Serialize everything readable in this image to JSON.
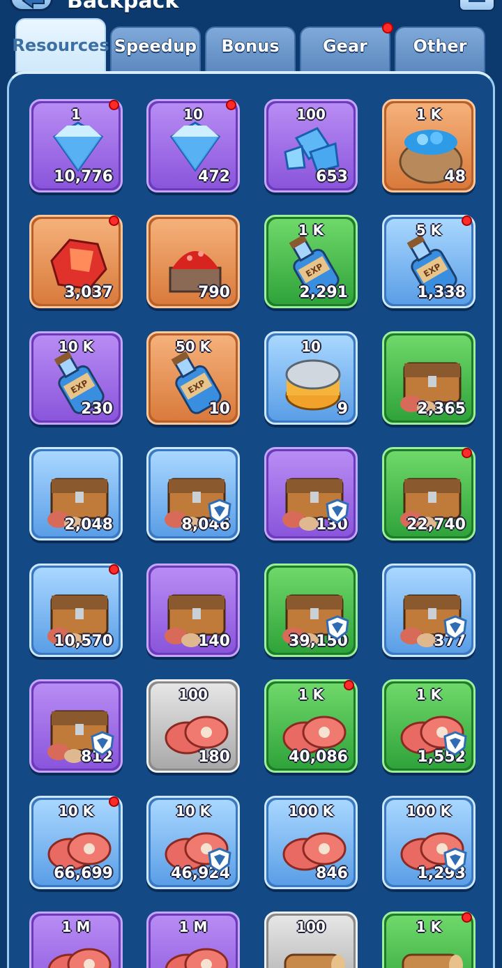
{
  "header": {
    "title": "Backpack",
    "back_icon": "back-arrow-icon",
    "menu_icon": "list-menu-icon"
  },
  "tabs": [
    {
      "label": "Resources",
      "active": true,
      "dot": false
    },
    {
      "label": "Speedup",
      "active": false,
      "dot": false
    },
    {
      "label": "Bonus",
      "active": false,
      "dot": false
    },
    {
      "label": "Gear",
      "active": false,
      "dot": true
    },
    {
      "label": "Other",
      "active": false,
      "dot": false
    }
  ],
  "colors": {
    "purple": "#8a55db",
    "orange": "#d97a3c",
    "green": "#2fa33a",
    "blue": "#5a9ee6",
    "gray": "#a9a9a9",
    "dot": "#ff2b2b",
    "panel": "#134a86"
  },
  "items": [
    {
      "rarity": "purple",
      "icon": "gem-single-icon",
      "denom": "1",
      "count": "10,776",
      "dot": true,
      "shield": false
    },
    {
      "rarity": "purple",
      "icon": "gem-pile-icon",
      "denom": "10",
      "count": "472",
      "dot": true,
      "shield": false
    },
    {
      "rarity": "purple",
      "icon": "gem-cluster-icon",
      "denom": "100",
      "count": "653",
      "dot": false,
      "shield": false
    },
    {
      "rarity": "orange",
      "icon": "gem-sack-icon",
      "denom": "1 K",
      "count": "48",
      "dot": false,
      "shield": false
    },
    {
      "rarity": "orange",
      "icon": "ruby-ore-icon",
      "denom": "",
      "count": "3,037",
      "dot": true,
      "shield": false
    },
    {
      "rarity": "orange",
      "icon": "ruby-cart-icon",
      "denom": "",
      "count": "790",
      "dot": false,
      "shield": false
    },
    {
      "rarity": "green",
      "icon": "exp-bottle-icon",
      "denom": "1 K",
      "count": "2,291",
      "dot": false,
      "shield": false
    },
    {
      "rarity": "blue",
      "icon": "exp-bottle-icon",
      "denom": "5 K",
      "count": "1,338",
      "dot": true,
      "shield": false
    },
    {
      "rarity": "purple",
      "icon": "exp-bottle-icon",
      "denom": "10 K",
      "count": "230",
      "dot": false,
      "shield": false
    },
    {
      "rarity": "orange",
      "icon": "exp-bottle-icon",
      "denom": "50 K",
      "count": "10",
      "dot": false,
      "shield": false
    },
    {
      "rarity": "blue",
      "icon": "canned-food-icon",
      "denom": "10",
      "count": "9",
      "dot": false,
      "shield": false
    },
    {
      "rarity": "green",
      "icon": "mystery-chest-icon",
      "denom": "",
      "count": "2,365",
      "dot": false,
      "shield": false
    },
    {
      "rarity": "blue",
      "icon": "mystery-chest-icon",
      "denom": "",
      "count": "2,048",
      "dot": false,
      "shield": false
    },
    {
      "rarity": "blue",
      "icon": "mystery-chest-icon",
      "denom": "",
      "count": "8,046",
      "dot": false,
      "shield": true
    },
    {
      "rarity": "purple",
      "icon": "mystery-chest-icon",
      "denom": "",
      "count": "130",
      "dot": false,
      "shield": true
    },
    {
      "rarity": "green",
      "icon": "resource-chest-icon",
      "denom": "",
      "count": "22,740",
      "dot": true,
      "shield": false
    },
    {
      "rarity": "blue",
      "icon": "resource-chest-icon",
      "denom": "",
      "count": "10,570",
      "dot": true,
      "shield": false
    },
    {
      "rarity": "purple",
      "icon": "dark-chest-icon",
      "denom": "",
      "count": "140",
      "dot": false,
      "shield": false
    },
    {
      "rarity": "green",
      "icon": "resource-chest-icon",
      "denom": "",
      "count": "39,150",
      "dot": false,
      "shield": true
    },
    {
      "rarity": "blue",
      "icon": "resource-chest-icon",
      "denom": "",
      "count": "377",
      "dot": false,
      "shield": true
    },
    {
      "rarity": "purple",
      "icon": "dark-chest-icon",
      "denom": "",
      "count": "812",
      "dot": false,
      "shield": true
    },
    {
      "rarity": "gray",
      "icon": "meat-icon",
      "denom": "100",
      "count": "180",
      "dot": false,
      "shield": false
    },
    {
      "rarity": "green",
      "icon": "meat-icon",
      "denom": "1 K",
      "count": "40,086",
      "dot": true,
      "shield": false
    },
    {
      "rarity": "green",
      "icon": "meat-icon",
      "denom": "1 K",
      "count": "1,552",
      "dot": false,
      "shield": true
    },
    {
      "rarity": "blue",
      "icon": "meat-plate-icon",
      "denom": "10 K",
      "count": "66,699",
      "dot": true,
      "shield": false
    },
    {
      "rarity": "blue",
      "icon": "meat-plate-icon",
      "denom": "10 K",
      "count": "46,924",
      "dot": false,
      "shield": true
    },
    {
      "rarity": "blue",
      "icon": "meat-sack-icon",
      "denom": "100 K",
      "count": "846",
      "dot": false,
      "shield": false
    },
    {
      "rarity": "blue",
      "icon": "meat-sack-icon",
      "denom": "100 K",
      "count": "1,293",
      "dot": false,
      "shield": true
    },
    {
      "rarity": "purple",
      "icon": "meat-cart-icon",
      "denom": "1 M",
      "count": "",
      "dot": false,
      "shield": false
    },
    {
      "rarity": "purple",
      "icon": "meat-cart-icon",
      "denom": "1 M",
      "count": "",
      "dot": false,
      "shield": false
    },
    {
      "rarity": "gray",
      "icon": "wood-log-icon",
      "denom": "100",
      "count": "",
      "dot": false,
      "shield": false
    },
    {
      "rarity": "green",
      "icon": "wood-logs-icon",
      "denom": "1 K",
      "count": "",
      "dot": true,
      "shield": false
    }
  ]
}
